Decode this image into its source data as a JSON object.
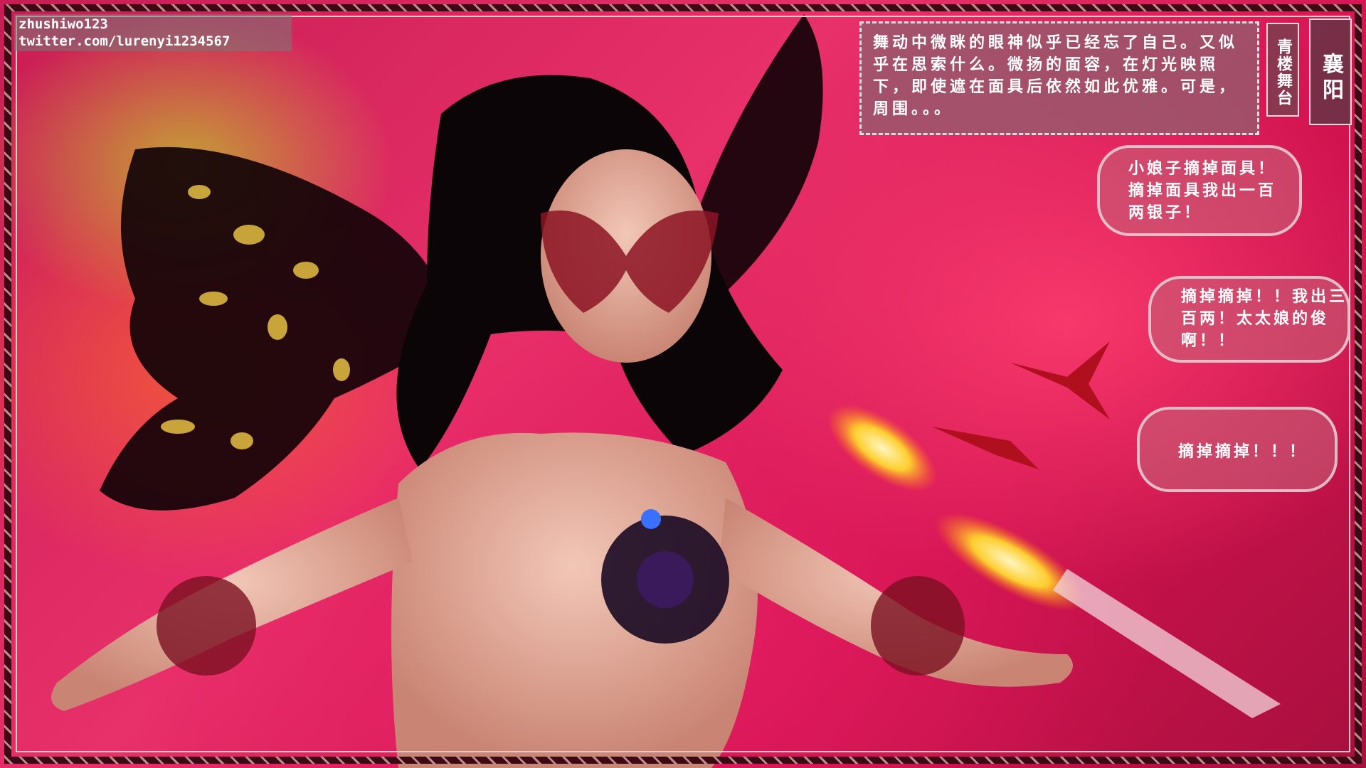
{
  "watermark": {
    "line1": "zhushiwo123",
    "line2": "twitter.com/lurenyi1234567"
  },
  "labels": {
    "place": "青楼舞台",
    "city": "襄阳"
  },
  "narration": "舞动中微眯的眼神似乎已经忘了自己。又似乎在思索什么。微扬的面容，在灯光映照下，即使遮在面具后依然如此优雅。可是，周围。。。",
  "bubbles": [
    {
      "text": "小娘子摘掉面具！摘掉面具我出一百两银子！"
    },
    {
      "text": "摘掉摘掉！！我出三百两！太太娘的俊啊！！"
    },
    {
      "text": "摘掉摘掉！！！"
    }
  ],
  "colors": {
    "background_main": "#e8306a",
    "glow_yellow": "#c8c828",
    "panel_fill": "#96596e"
  }
}
